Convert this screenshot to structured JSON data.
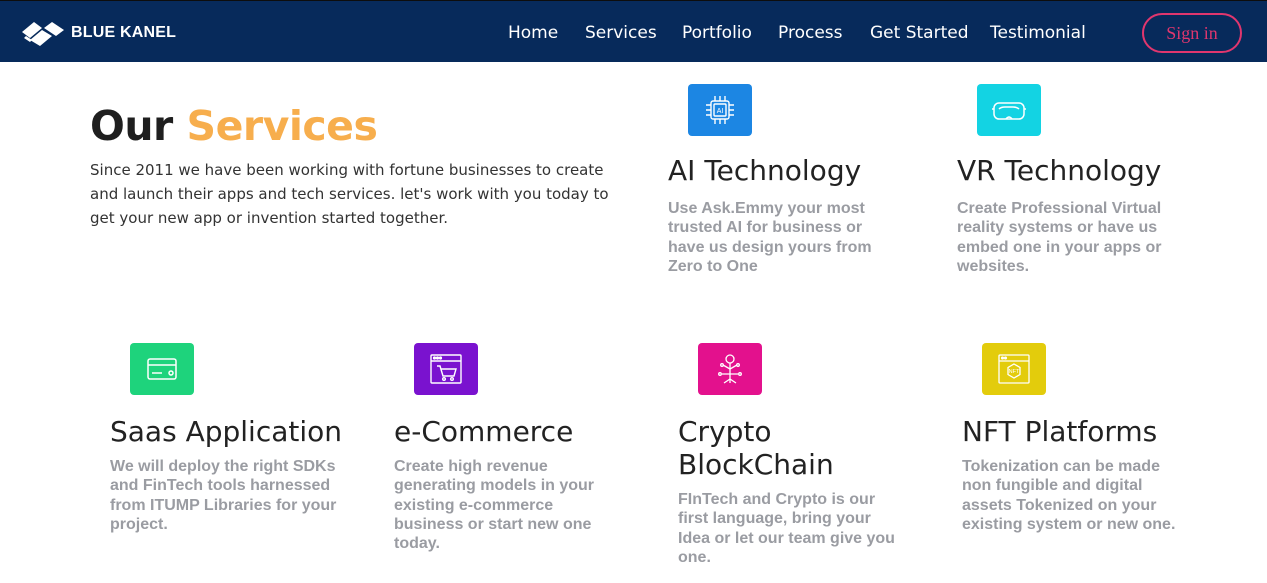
{
  "brand": {
    "name": "BLUE KANEL"
  },
  "nav": {
    "links": [
      "Home",
      "Services",
      "Portfolio",
      "Process",
      "Get Started",
      "Testimonial"
    ],
    "signin_label": "Sign in"
  },
  "hero": {
    "title_part1": "Our",
    "title_part2": "Services",
    "description": "Since 2011 we have been working with fortune businesses to create and launch their apps and tech services. let's work with you today to get your new app or invention started together."
  },
  "services": [
    {
      "title": "AI Technology",
      "description": "Use Ask.Emmy your most trusted AI for business or have us design yours from Zero to One",
      "icon": "ai-chip-icon",
      "color": "#1c86e3"
    },
    {
      "title": "VR Technology",
      "description": "Create Professional Virtual reality systems or have us embed one in your apps or websites.",
      "icon": "vr-headset-icon",
      "color": "#13d3e3"
    },
    {
      "title": "Saas Application",
      "description": "We will deploy the right SDKs and FinTech tools harnessed from ITUMP Libraries for your project.",
      "icon": "credit-card-icon",
      "color": "#1ed37c"
    },
    {
      "title": "e-Commerce",
      "description": "Create high revenue generating models in your existing e-commerce business or start new one today.",
      "icon": "shopping-cart-icon",
      "color": "#7a12cf"
    },
    {
      "title": "Crypto BlockChain",
      "description": "FInTech and Crypto is our first language, bring your Idea or let our team give you one.",
      "icon": "blockchain-key-icon",
      "color": "#e3118d"
    },
    {
      "title": "NFT Platforms",
      "description": "Tokenization can be made non fungible and digital assets Tokenized on your existing system or new one.",
      "icon": "nft-token-icon",
      "color": "#e3cc0c"
    }
  ]
}
